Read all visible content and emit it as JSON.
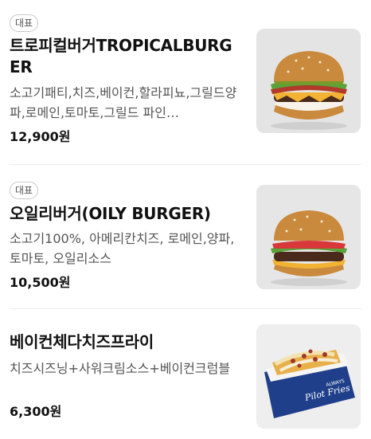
{
  "menu": {
    "items": [
      {
        "badge": "대표",
        "name": "트로피컬버거TROPICALBURGER",
        "description": "소고기패티,치즈,베이컨,할라피뇨,그릴드양파,로메인,토마토,그릴드 파인…",
        "price": "12,900원",
        "image_icon": "burger-image"
      },
      {
        "badge": "대표",
        "name": "오일리버거(OILY BURGER)",
        "description": "소고기100%, 아메리칸치즈, 로메인,양파, 토마토, 오일리소스",
        "price": "10,500원",
        "image_icon": "burger-image"
      },
      {
        "name": "베이컨체다치즈프라이",
        "description": "치즈시즈닝+사워크림소스+베이컨크럼블",
        "price": "6,300원",
        "image_icon": "fries-box-image",
        "box_text": [
          "Pilot Fries",
          "ALWAYS"
        ]
      }
    ]
  },
  "colors": {
    "bun": "#c98a3e",
    "patty": "#4a2a1a",
    "lettuce": "#5aa23a",
    "cheese": "#f2b233",
    "fries_box": "#1f3f8a"
  }
}
